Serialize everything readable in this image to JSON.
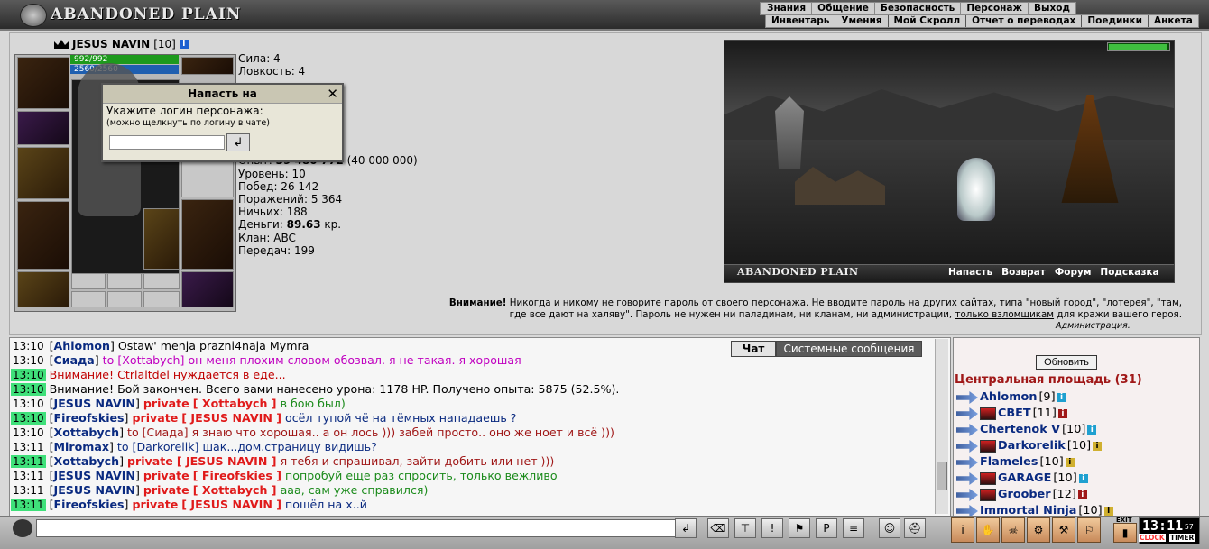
{
  "header": {
    "logo_text": "ABANDONED PLAIN",
    "menu_main": [
      "Знания",
      "Общение",
      "Безопасность",
      "Персонаж",
      "Выход"
    ],
    "menu_sub": [
      "Инвентарь",
      "Умения",
      "Мой Скролл",
      "Отчет о переводах",
      "Поединки",
      "Анкета"
    ]
  },
  "character": {
    "name": "JESUS NAVIN",
    "level": "[10]",
    "hp": "992/992",
    "mp": "2560/2560",
    "stats": {
      "strength": "Сила: 4",
      "agility": "Ловкость: 4",
      "experience_label": "Опыт: ",
      "experience_value": "39 480 772",
      "experience_next": " (40 000 000)",
      "level": "Уровень: 10",
      "wins": "Побед: 26 142",
      "losses": "Поражений: 5 364",
      "draws": "Ничьих: 188",
      "money_label": "Деньги: ",
      "money_value": "89.63",
      "money_unit": " кр.",
      "clan": "Клан: ABC",
      "transfers": "Передач: 199"
    }
  },
  "attack_popup": {
    "title": "Напасть на",
    "label": "Укажите логин персонажа:",
    "hint": "(можно щелкнуть по логину в чате)",
    "input_value": "",
    "close_glyph": "✕",
    "submit_glyph": "↲"
  },
  "scene": {
    "title": "ABANDONED PLAIN",
    "links": [
      "Напасть",
      "Возврат",
      "Форум",
      "Подсказка"
    ],
    "hp_fill_fraction": 0.94
  },
  "warning": {
    "bold": "Внимание!",
    "text": " Никогда и никому не говорите пароль от своего персонажа. Не вводите пароль на других сайтах, типа \"новый город\", \"лотерея\", \"там, где все дают на халяву\". Пароль не нужен ни паладинам, ни кланам, ни администрации, ",
    "link": "только взломщикам",
    "text_end": " для кражи вашего героя.",
    "signature": "Администрация."
  },
  "chat": {
    "tabs": [
      "Чат",
      "Системные сообщения"
    ],
    "lines": [
      {
        "time": "13:10",
        "hl": false,
        "nick": "Ahlomon",
        "private": "",
        "target": "",
        "to": "",
        "text": " Ostaw' menja prazni4naja Mymra",
        "color": "#000000"
      },
      {
        "time": "13:10",
        "hl": false,
        "nick": "Сиада",
        "private": "",
        "target": "",
        "to": "to [Xottabych]",
        "text": " он меня плохим словом обозвал. я не такая. я хорошая",
        "color": "#c000c0"
      },
      {
        "time": "13:10",
        "hl": true,
        "nick": "",
        "private": "",
        "target": "",
        "to": "",
        "text": "Внимание! Ctrlaltdel нуждается в еде...",
        "color": "#c00000"
      },
      {
        "time": "13:10",
        "hl": true,
        "nick": "",
        "private": "",
        "target": "",
        "to": "",
        "text": "Внимание! Бой закончен. Всего вами нанесено урона: 1178 HP. Получено опыта: 5875 (52.5%).",
        "color": "#000000"
      },
      {
        "time": "13:10",
        "hl": false,
        "nick": "JESUS NAVIN",
        "private": "private",
        "target": "[ Xottabych ]",
        "to": "",
        "text": " в бою был)",
        "color": "#1a8a1a"
      },
      {
        "time": "13:10",
        "hl": true,
        "nick": "Fireofskies",
        "private": "private",
        "target": "[ JESUS NAVIN ]",
        "to": "",
        "text": " осёл тупой чё на тёмных нападаешь ?",
        "color": "#0a2a80"
      },
      {
        "time": "13:10",
        "hl": false,
        "nick": "Xottabych",
        "private": "",
        "target": "",
        "to": "to [Сиада]",
        "text": " я знаю что хорошая.. а он лось ))) забей просто.. оно же ноет и всё )))",
        "color": "#a01818"
      },
      {
        "time": "13:11",
        "hl": false,
        "nick": "Miromax",
        "private": "",
        "target": "",
        "to": "to [Darkorelik]",
        "text": " шак...дом.страницу видишь?",
        "color": "#0a2a80"
      },
      {
        "time": "13:11",
        "hl": true,
        "nick": "Xottabych",
        "private": "private",
        "target": "[ JESUS NAVIN ]",
        "to": "",
        "text": " я тебя и спрашивал, зайти добить или нет )))",
        "color": "#a01818"
      },
      {
        "time": "13:11",
        "hl": false,
        "nick": "JESUS NAVIN",
        "private": "private",
        "target": "[ Fireofskies ]",
        "to": "",
        "text": " попробуй еще раз спросить, только вежливо",
        "color": "#1a8a1a"
      },
      {
        "time": "13:11",
        "hl": false,
        "nick": "JESUS NAVIN",
        "private": "private",
        "target": "[ Xottabych ]",
        "to": "",
        "text": " ааа, сам уже справился)",
        "color": "#1a8a1a"
      },
      {
        "time": "13:11",
        "hl": true,
        "nick": "Fireofskies",
        "private": "private",
        "target": "[ JESUS NAVIN ]",
        "to": "",
        "text": " пошёл на х..й",
        "color": "#0a2a80"
      }
    ],
    "input_value": ""
  },
  "online": {
    "refresh_label": "Обновить",
    "location": "Центральная площадь (31)",
    "users": [
      {
        "name": "Ahlomon",
        "level": "[9]",
        "badge": "blue"
      },
      {
        "name": "CBET",
        "level": "[11]",
        "badge": "red"
      },
      {
        "name": "Chertenok V",
        "level": "[10]",
        "badge": "blue"
      },
      {
        "name": "Darkorelik",
        "level": "[10]",
        "badge": "yellow"
      },
      {
        "name": "Flameles",
        "level": "[10]",
        "badge": "yellow"
      },
      {
        "name": "GARAGE",
        "level": "[10]",
        "badge": "blue"
      },
      {
        "name": "Groober",
        "level": "[12]",
        "badge": "red"
      },
      {
        "name": "Immortal Ninja",
        "level": "[10]",
        "badge": "yellow"
      }
    ]
  },
  "bottombar": {
    "clock_time": "13:11",
    "clock_seconds": "57",
    "clock_label": "CLOCK",
    "timer_label": "TIMER",
    "exit_label": "EXIT"
  },
  "colors": {
    "nick": "#0a2a80",
    "private": "#e01a1a",
    "highlight_time": "#3fe07a",
    "location": "#a01818"
  }
}
